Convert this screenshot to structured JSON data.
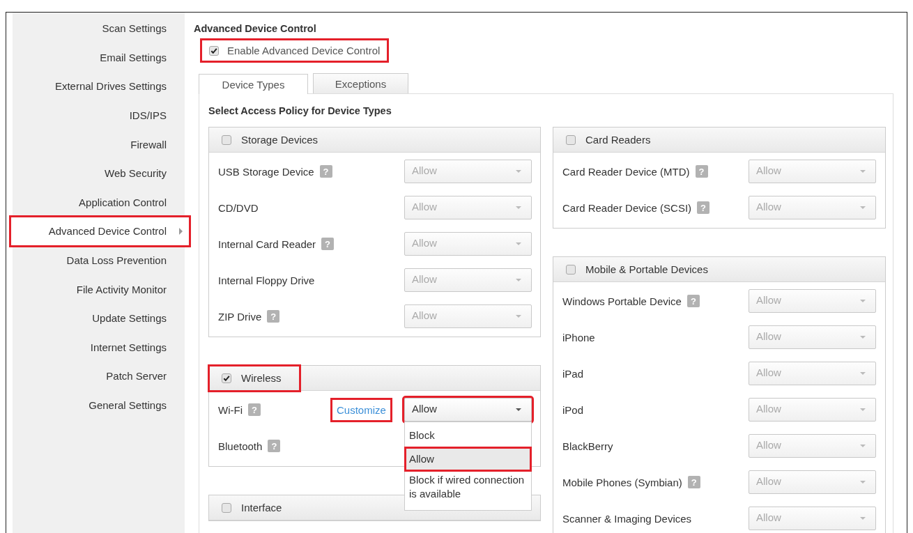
{
  "sidebar": {
    "items": [
      {
        "label": "Scan Settings",
        "selected": false,
        "highlighted": false
      },
      {
        "label": "Email Settings",
        "selected": false,
        "highlighted": false
      },
      {
        "label": "External Drives Settings",
        "selected": false,
        "highlighted": false
      },
      {
        "label": "IDS/IPS",
        "selected": false,
        "highlighted": false
      },
      {
        "label": "Firewall",
        "selected": false,
        "highlighted": false
      },
      {
        "label": "Web Security",
        "selected": false,
        "highlighted": false
      },
      {
        "label": "Application Control",
        "selected": false,
        "highlighted": false
      },
      {
        "label": "Advanced Device Control",
        "selected": true,
        "highlighted": true
      },
      {
        "label": "Data Loss Prevention",
        "selected": false,
        "highlighted": false
      },
      {
        "label": "File Activity Monitor",
        "selected": false,
        "highlighted": false
      },
      {
        "label": "Update Settings",
        "selected": false,
        "highlighted": false
      },
      {
        "label": "Internet Settings",
        "selected": false,
        "highlighted": false
      },
      {
        "label": "Patch Server",
        "selected": false,
        "highlighted": false
      },
      {
        "label": "General Settings",
        "selected": false,
        "highlighted": false
      }
    ]
  },
  "page_title": "Advanced Device Control",
  "enable": {
    "label": "Enable Advanced Device Control",
    "checked": true,
    "highlighted": true
  },
  "tabs": [
    {
      "label": "Device Types",
      "selected": true
    },
    {
      "label": "Exceptions",
      "selected": false
    }
  ],
  "section_heading": "Select Access Policy for Device Types",
  "left_panels": [
    {
      "title": "Storage Devices",
      "checked": false,
      "highlighted": false,
      "rows": [
        {
          "label": "USB Storage Device",
          "help": "?",
          "select": {
            "value": "Allow",
            "disabled": true,
            "highlighted": false
          }
        },
        {
          "label": "CD/DVD",
          "select": {
            "value": "Allow",
            "disabled": true,
            "highlighted": false
          }
        },
        {
          "label": "Internal Card Reader",
          "help": "?",
          "select": {
            "value": "Allow",
            "disabled": true,
            "highlighted": false
          }
        },
        {
          "label": "Internal Floppy Drive",
          "select": {
            "value": "Allow",
            "disabled": true,
            "highlighted": false
          }
        },
        {
          "label": "ZIP Drive",
          "help": "?",
          "select": {
            "value": "Allow",
            "disabled": true,
            "highlighted": false
          }
        }
      ]
    },
    {
      "title": "Wireless",
      "checked": true,
      "highlighted": true,
      "rows": [
        {
          "label": "Wi-Fi",
          "help": "?",
          "link": {
            "label": "Customize",
            "highlighted": true
          },
          "select": {
            "value": "Allow",
            "disabled": false,
            "highlighted": true,
            "options": [
              {
                "label": "Block",
                "selected": false,
                "highlighted": false
              },
              {
                "label": "Allow",
                "selected": true,
                "highlighted": true
              },
              {
                "label": "Block if wired connection is available",
                "selected": false,
                "highlighted": false
              }
            ]
          }
        },
        {
          "label": "Bluetooth",
          "help": "?"
        }
      ]
    },
    {
      "title": "Interface",
      "checked": false,
      "highlighted": false
    }
  ],
  "right_panels": [
    {
      "title": "Card Readers",
      "checked": false,
      "highlighted": false,
      "rows": [
        {
          "label": "Card Reader Device (MTD)",
          "help": "?",
          "select": {
            "value": "Allow",
            "disabled": true,
            "highlighted": false
          }
        },
        {
          "label": "Card Reader Device (SCSI)",
          "help": "?",
          "select": {
            "value": "Allow",
            "disabled": true,
            "highlighted": false
          }
        }
      ]
    },
    {
      "title": "Mobile & Portable Devices",
      "checked": false,
      "highlighted": false,
      "rows": [
        {
          "label": "Windows Portable Device",
          "help": "?",
          "select": {
            "value": "Allow",
            "disabled": true,
            "highlighted": false
          }
        },
        {
          "label": "iPhone",
          "select": {
            "value": "Allow",
            "disabled": true,
            "highlighted": false
          }
        },
        {
          "label": "iPad",
          "select": {
            "value": "Allow",
            "disabled": true,
            "highlighted": false
          }
        },
        {
          "label": "iPod",
          "select": {
            "value": "Allow",
            "disabled": true,
            "highlighted": false
          }
        },
        {
          "label": "BlackBerry",
          "select": {
            "value": "Allow",
            "disabled": true,
            "highlighted": false
          }
        },
        {
          "label": "Mobile Phones (Symbian)",
          "help": "?",
          "select": {
            "value": "Allow",
            "disabled": true,
            "highlighted": false
          }
        },
        {
          "label": "Scanner & Imaging Devices",
          "select": {
            "value": "Allow",
            "disabled": true,
            "highlighted": false
          }
        }
      ]
    }
  ]
}
